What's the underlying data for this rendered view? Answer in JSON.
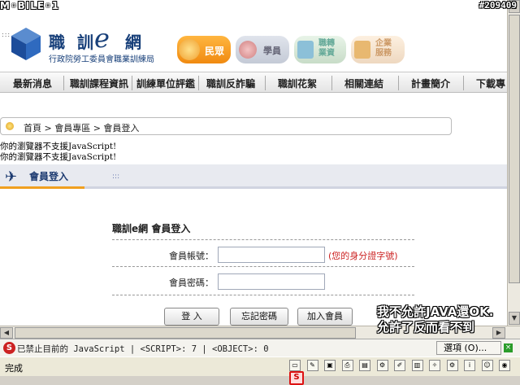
{
  "watermark": "M◦BILE◦1",
  "image_id": "#209409",
  "site": {
    "title_part1": "職 訓",
    "title_e": "e",
    "title_part2": "網",
    "subtitle": "行政院勞工委員會職業訓練局"
  },
  "audience": [
    {
      "label": "民眾"
    },
    {
      "label": "學員"
    },
    {
      "label": "職轉\n業資"
    },
    {
      "label": "企業\n服務"
    }
  ],
  "nav": [
    "最新消息",
    "職訓課程資訊",
    "訓練單位評鑑",
    "職訓反詐騙",
    "職訓花絮",
    "相關連結",
    "計畫簡介",
    "下載專"
  ],
  "breadcrumb": "首頁 > 會員專區 > 會員登入",
  "nojs_messages": [
    "你的瀏覽器不支援JavaScript!",
    "你的瀏覽器不支援JavaScript!"
  ],
  "section_title": "會員登入",
  "section_dots": ":::",
  "top_dots": ":::",
  "login": {
    "heading": "職訓e網 會員登入",
    "account_label": "會員帳號：",
    "account_value": "",
    "account_hint": "(您的身分證字號)",
    "password_label": "會員密碼：",
    "password_value": ""
  },
  "buttons": {
    "login": "登 入",
    "forgot": "忘記密碼",
    "join": "加入會員"
  },
  "overlay_note": [
    "我不允許JAVA還OK.",
    "允許了反而看不到"
  ],
  "noscript_bar": {
    "text": "已禁止目前的 JavaScript | <SCRIPT>: 7 | <OBJECT>: 0",
    "options_label": "選項 (O)..."
  },
  "status": "完成",
  "colors": {
    "brand": "#18407a",
    "accent": "#f0a020",
    "hint": "#cc2222"
  }
}
